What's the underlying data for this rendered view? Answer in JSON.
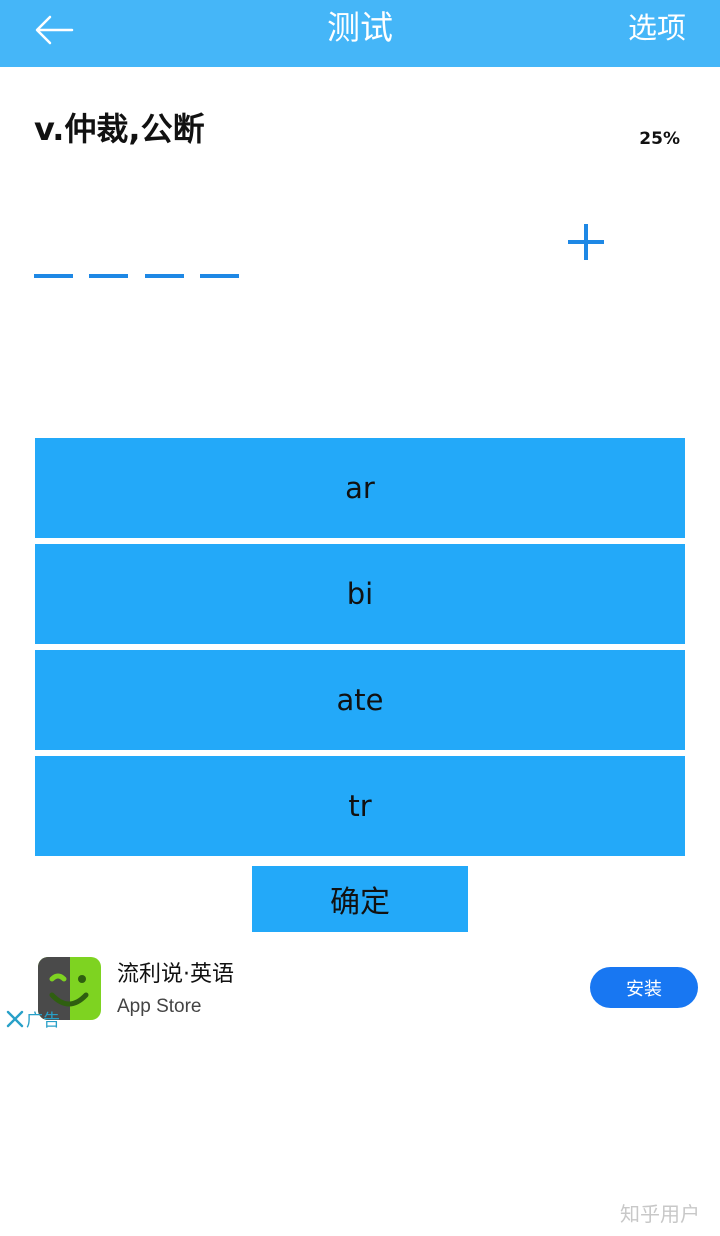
{
  "header": {
    "title": "测试",
    "options_label": "选项",
    "back_icon": "arrow-left-icon",
    "background": "#45b6f8"
  },
  "question": {
    "definition": "v.仲裁,公断",
    "progress": "25%",
    "progress_value": 0.25,
    "slot_count": 4,
    "add_icon": "plus-icon"
  },
  "options": [
    {
      "label": "ar"
    },
    {
      "label": "bi"
    },
    {
      "label": "ate"
    },
    {
      "label": "tr"
    }
  ],
  "confirm_label": "确定",
  "ad": {
    "app_name": "流利说·英语",
    "store": "App Store",
    "install_label": "安装",
    "tag": "广告",
    "close_icon": "close-icon"
  },
  "watermark": "知乎用户",
  "colors": {
    "accent": "#23a9f9",
    "slot": "#1e88e5",
    "install": "#1877f2"
  }
}
